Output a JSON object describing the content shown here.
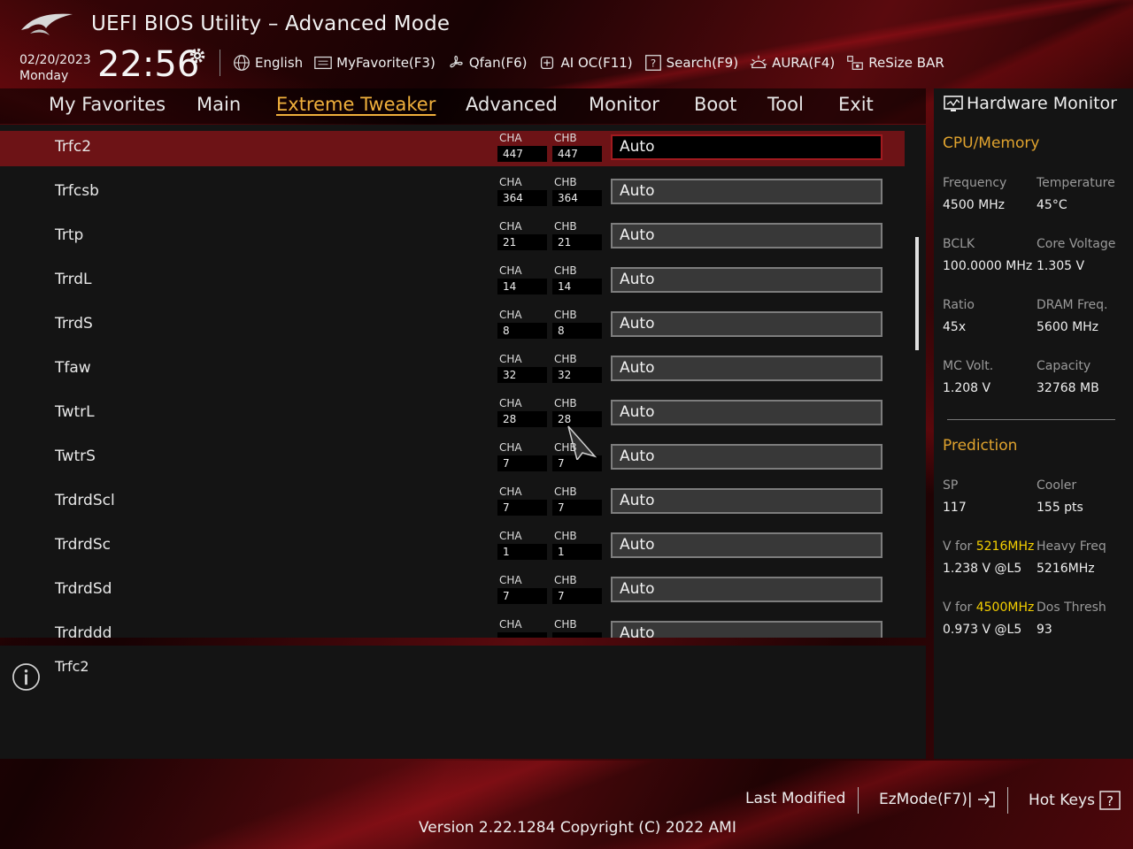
{
  "header": {
    "title": "UEFI BIOS Utility – Advanced Mode",
    "date": "02/20/2023",
    "day": "Monday",
    "time": "22:56"
  },
  "toolbar": [
    {
      "label": "English",
      "icon": "globe-icon"
    },
    {
      "label": "MyFavorite(F3)",
      "icon": "favorites-icon"
    },
    {
      "label": "Qfan(F6)",
      "icon": "fan-icon"
    },
    {
      "label": "AI OC(F11)",
      "icon": "ai-oc-icon"
    },
    {
      "label": "Search(F9)",
      "icon": "search-icon"
    },
    {
      "label": "AURA(F4)",
      "icon": "aura-icon"
    },
    {
      "label": "ReSize BAR",
      "icon": "resize-bar-icon"
    }
  ],
  "nav": [
    "My Favorites",
    "Main",
    "Extreme Tweaker",
    "Advanced",
    "Monitor",
    "Boot",
    "Tool",
    "Exit"
  ],
  "nav_active": "Extreme Tweaker",
  "rows": [
    {
      "label": "Trfc2",
      "cha": "447",
      "chb": "447",
      "value": "Auto"
    },
    {
      "label": "Trfcsb",
      "cha": "364",
      "chb": "364",
      "value": "Auto"
    },
    {
      "label": "Trtp",
      "cha": "21",
      "chb": "21",
      "value": "Auto"
    },
    {
      "label": "TrrdL",
      "cha": "14",
      "chb": "14",
      "value": "Auto"
    },
    {
      "label": "TrrdS",
      "cha": "8",
      "chb": "8",
      "value": "Auto"
    },
    {
      "label": "Tfaw",
      "cha": "32",
      "chb": "32",
      "value": "Auto"
    },
    {
      "label": "TwtrL",
      "cha": "28",
      "chb": "28",
      "value": "Auto"
    },
    {
      "label": "TwtrS",
      "cha": "7",
      "chb": "7",
      "value": "Auto"
    },
    {
      "label": "TrdrdScl",
      "cha": "7",
      "chb": "7",
      "value": "Auto"
    },
    {
      "label": "TrdrdSc",
      "cha": "1",
      "chb": "1",
      "value": "Auto"
    },
    {
      "label": "TrdrdSd",
      "cha": "7",
      "chb": "7",
      "value": "Auto"
    },
    {
      "label": "Trdrddd",
      "cha": "",
      "chb": "",
      "value": "Auto"
    }
  ],
  "channel_labels": {
    "a": "CHA",
    "b": "CHB"
  },
  "help": {
    "text": "Trfc2"
  },
  "hw": {
    "title": "Hardware Monitor",
    "cpu_section": "CPU/Memory",
    "cpu": [
      {
        "label": "Frequency",
        "value": "4500 MHz"
      },
      {
        "label": "Temperature",
        "value": "45°C"
      },
      {
        "label": "BCLK",
        "value": "100.0000 MHz"
      },
      {
        "label": "Core Voltage",
        "value": "1.305 V"
      },
      {
        "label": "Ratio",
        "value": "45x"
      },
      {
        "label": "DRAM Freq.",
        "value": "5600 MHz"
      },
      {
        "label": "MC Volt.",
        "value": "1.208 V"
      },
      {
        "label": "Capacity",
        "value": "32768 MB"
      }
    ],
    "prediction_section": "Prediction",
    "pred": {
      "sp_label": "SP",
      "sp_value": "117",
      "cooler_label": "Cooler",
      "cooler_value": "155 pts",
      "v1_prefix": "V for ",
      "v1_freq": "5216MHz",
      "v1_value": "1.238 V @L5",
      "heavy_label": "Heavy Freq",
      "heavy_value": "5216MHz",
      "v2_prefix": "V for ",
      "v2_freq": "4500MHz",
      "v2_value": "0.973 V @L5",
      "dos_label": "Dos Thresh",
      "dos_value": "93"
    }
  },
  "footer": {
    "last_modified": "Last Modified",
    "ezmode": "EzMode(F7)|",
    "hotkeys": "Hot Keys",
    "version": "Version 2.22.1284 Copyright (C) 2022 AMI"
  },
  "colors": {
    "accent": "#e0a32e",
    "selected_row": "#6d1316",
    "highlight": "#f5d000"
  }
}
